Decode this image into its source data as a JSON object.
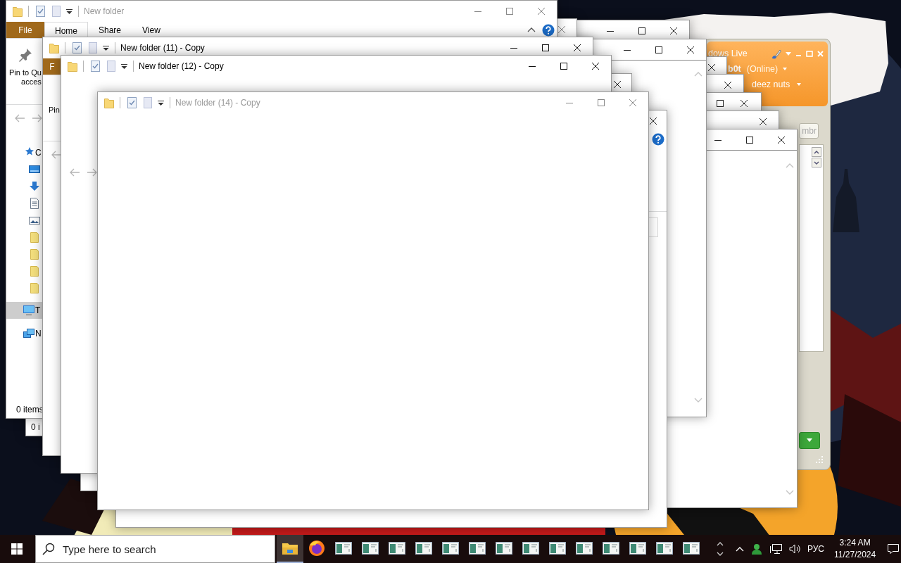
{
  "windows": [
    {
      "title": "New folder",
      "active": false,
      "ribbon": {
        "tabs": [
          {
            "label": "File",
            "kind": "file",
            "selected": false
          },
          {
            "label": "Home",
            "kind": "tab",
            "selected": true
          },
          {
            "label": "Share",
            "kind": "tab",
            "selected": false
          },
          {
            "label": "View",
            "kind": "tab",
            "selected": false
          }
        ],
        "pin_label": "Pin to Qu\nacces"
      },
      "nav_items": [
        {
          "label": "C",
          "kind": "quick-access",
          "selected": false
        },
        {
          "kind": "desktop",
          "selected": false
        },
        {
          "kind": "downloads",
          "selected": false
        },
        {
          "kind": "documents",
          "selected": false
        },
        {
          "kind": "pictures",
          "selected": false
        },
        {
          "kind": "folder",
          "selected": false
        },
        {
          "kind": "folder",
          "selected": false
        },
        {
          "kind": "folder",
          "selected": false
        },
        {
          "kind": "folder",
          "selected": false
        },
        {
          "label": "T",
          "kind": "pc",
          "selected": true
        },
        {
          "label": "N",
          "kind": "network",
          "selected": false
        }
      ],
      "status": "0 items"
    },
    {
      "status": "0 i"
    },
    {
      "title": "New folder (11) - Copy",
      "active": true,
      "ribbon": {
        "tabs": [
          {
            "label": "F",
            "kind": "file",
            "selected": false
          }
        ],
        "pin_label": "Pin"
      }
    },
    {
      "title": "New folder (12) - Copy",
      "active": true
    },
    {
      "title": "New folder (14) - Copy",
      "active": false
    }
  ],
  "messenger": {
    "title": "dows Live",
    "user": "b0t",
    "status": "(Online)",
    "message": "deez nuts",
    "field": "mbr"
  },
  "taskbar": {
    "search": {
      "placeholder": "Type here to search"
    },
    "apps": [
      {
        "kind": "explorer",
        "selected": true
      },
      {
        "kind": "firefox",
        "selected": false
      },
      {
        "kind": "window",
        "selected": false
      },
      {
        "kind": "window",
        "selected": false
      },
      {
        "kind": "window",
        "selected": false
      },
      {
        "kind": "window",
        "selected": false
      },
      {
        "kind": "window",
        "selected": false
      },
      {
        "kind": "window",
        "selected": false
      },
      {
        "kind": "window",
        "selected": false
      },
      {
        "kind": "window",
        "selected": false
      },
      {
        "kind": "window",
        "selected": false
      },
      {
        "kind": "window",
        "selected": false
      },
      {
        "kind": "window",
        "selected": false
      },
      {
        "kind": "window",
        "selected": false
      },
      {
        "kind": "window",
        "selected": false
      },
      {
        "kind": "window",
        "selected": false
      }
    ],
    "language": "РУС",
    "time": "3:24 AM",
    "date": "11/27/2024"
  }
}
